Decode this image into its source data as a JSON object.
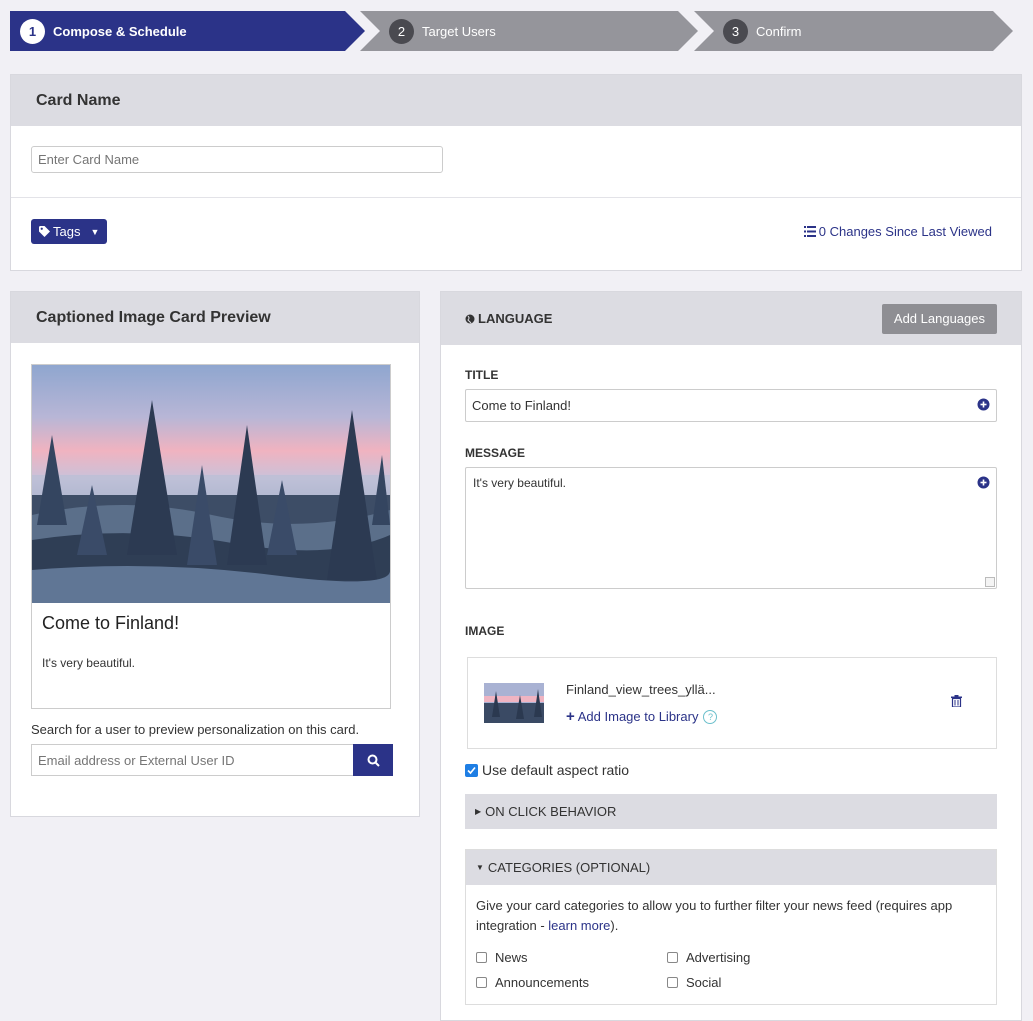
{
  "stepper": {
    "steps": [
      {
        "num": "1",
        "label": "Compose & Schedule"
      },
      {
        "num": "2",
        "label": "Target Users"
      },
      {
        "num": "3",
        "label": "Confirm"
      }
    ]
  },
  "card_name": {
    "header": "Card Name",
    "input_placeholder": "Enter Card Name",
    "tags_label": "Tags",
    "changes_label": "0 Changes Since Last Viewed"
  },
  "preview": {
    "header": "Captioned Image Card Preview",
    "card_title": "Come to Finland!",
    "card_message": "It's very beautiful.",
    "search_help": "Search for a user to preview personalization on this card.",
    "search_placeholder": "Email address or External User ID"
  },
  "language": {
    "header": "LANGUAGE",
    "add_languages": "Add Languages",
    "title_label": "TITLE",
    "title_value": "Come to Finland!",
    "message_label": "MESSAGE",
    "message_value": "It's very beautiful.",
    "image_label": "IMAGE",
    "image_filename": "Finland_view_trees_yllä...",
    "add_to_library": "Add Image to Library",
    "help_glyph": "?",
    "aspect_label": "Use default aspect ratio",
    "aspect_checked": true,
    "on_click_label": "ON CLICK BEHAVIOR",
    "categories_label": "CATEGORIES (OPTIONAL)",
    "categories_desc": "Give your card categories to allow you to further filter your news feed (requires app integration - ",
    "categories_link": "learn more",
    "categories_desc_end": ").",
    "categories": [
      "News",
      "Advertising",
      "Announcements",
      "Social"
    ]
  },
  "colors": {
    "primary": "#2b3388",
    "step_inactive": "#95959b",
    "panel_header": "#dcdce2",
    "checkbox_blue": "#1e7ee4"
  }
}
